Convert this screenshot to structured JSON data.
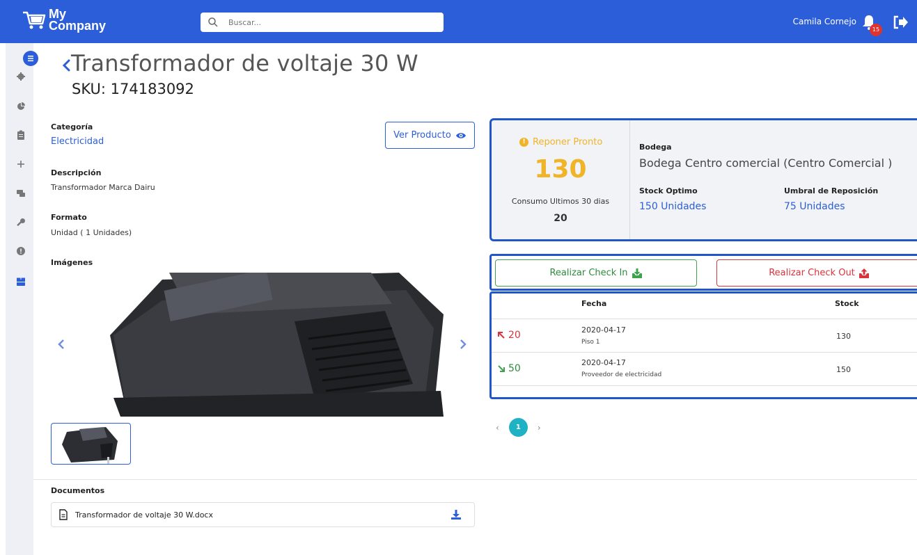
{
  "header": {
    "brand_line1": "My",
    "brand_line2": "Company",
    "search_placeholder": "Buscar...",
    "user_name": "Camila Cornejo",
    "notification_count": "15",
    "bar_color": "#2b5ed8"
  },
  "sidebar": {
    "icons": [
      "menu-icon",
      "gear-icon",
      "pie-chart-icon",
      "clipboard-icon",
      "plus-icon",
      "chat-icon",
      "wrench-icon",
      "alert-icon",
      "box-icon"
    ]
  },
  "product": {
    "title": "Transformador de voltaje 30 W",
    "sku": "SKU: 174183092",
    "view_button": "Ver Producto",
    "category_label": "Categoría",
    "category_value": "Electricidad",
    "description_label": "Descripción",
    "description_value": "Transformador Marca Dairu",
    "format_label": "Formato",
    "format_value": "Unidad ( 1 Unidades)",
    "images_label": "Imágenes",
    "documents_label": "Documentos",
    "document_name": "Transformador de voltaje 30 W.docx"
  },
  "stock": {
    "alert_text": "Reponer Pronto",
    "current_stock": "130",
    "consumption_label": "Consumo Ultimos 30 dias",
    "consumption_value": "20",
    "warehouse_label": "Bodega",
    "warehouse_value": "Bodega Centro comercial (Centro Comercial )",
    "optimal_label": "Stock Optimo",
    "optimal_value": "150 Unidades",
    "threshold_label": "Umbral de Reposición",
    "threshold_value": "75 Unidades",
    "alert_color": "#f0b429"
  },
  "actions": {
    "check_in": "Realizar Check In",
    "check_out": "Realizar Check Out"
  },
  "movements": {
    "headers": {
      "date": "Fecha",
      "stock": "Stock"
    },
    "rows": [
      {
        "qty": "20",
        "direction": "out",
        "date": "2020-04-17",
        "note": "Piso 1",
        "stock": "130"
      },
      {
        "qty": "50",
        "direction": "in",
        "date": "2020-04-17",
        "note": "Proveedor de electricidad",
        "stock": "150"
      }
    ]
  },
  "pagination": {
    "prev": "‹",
    "current": "1",
    "next": "›"
  }
}
